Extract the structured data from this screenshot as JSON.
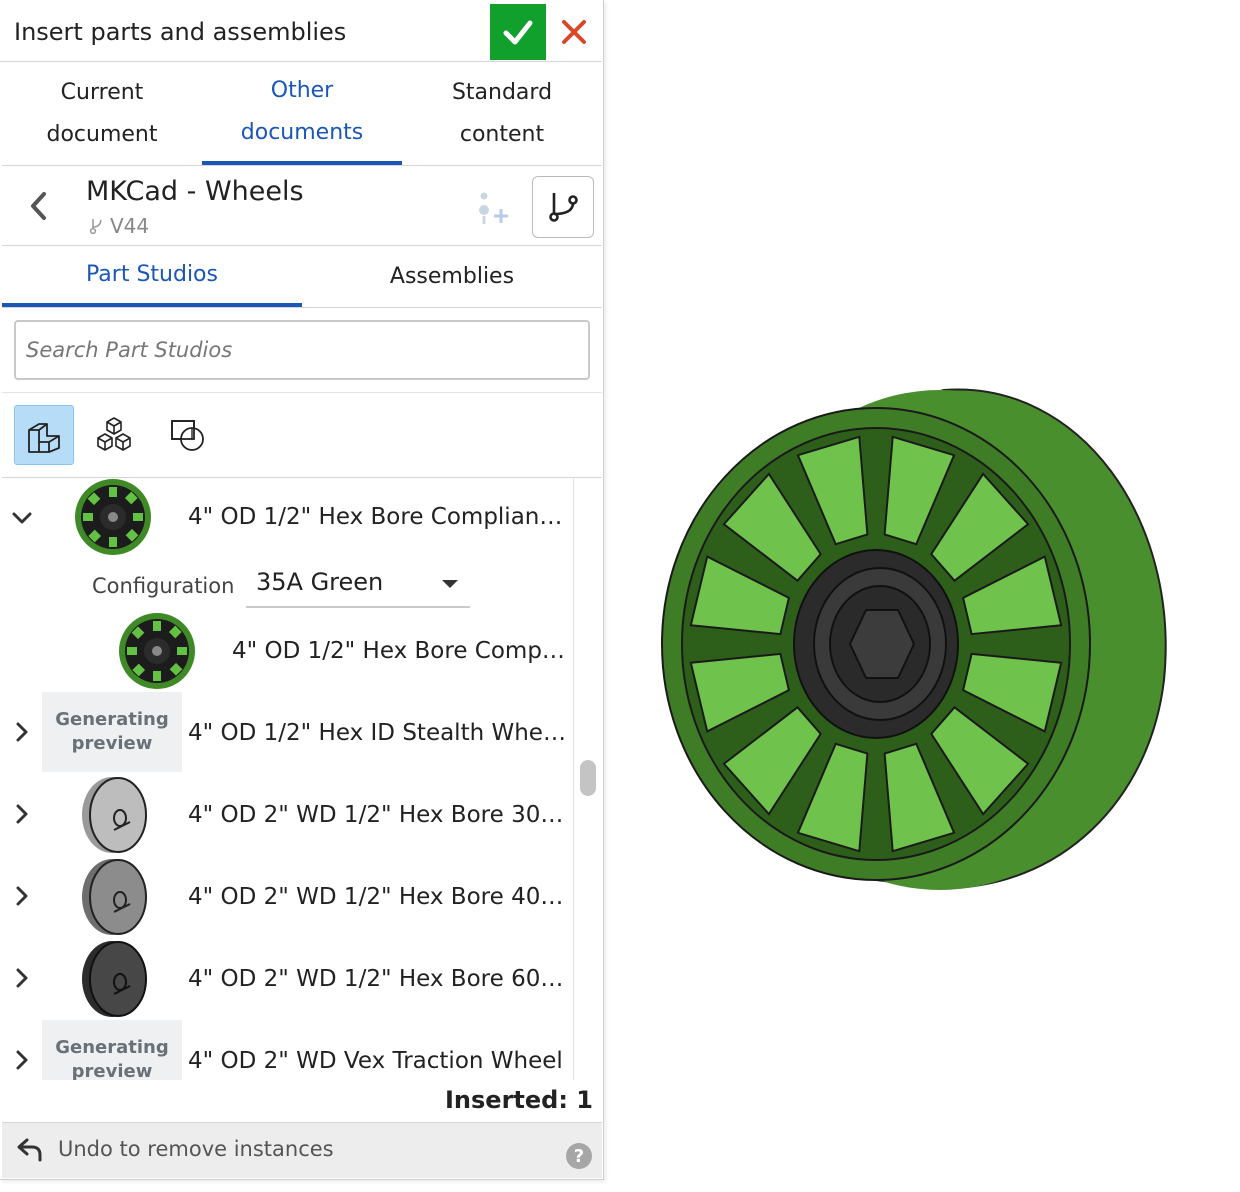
{
  "dialog": {
    "title": "Insert parts and assemblies",
    "accept_icon": "check-icon",
    "cancel_icon": "close-icon"
  },
  "top_tabs": [
    {
      "line1": "Current",
      "line2": "document",
      "active": false
    },
    {
      "line1": "Other",
      "line2": "documents",
      "active": true
    },
    {
      "line1": "Standard",
      "line2": "content",
      "active": false
    }
  ],
  "document": {
    "name": "MKCad - Wheels",
    "version": "V44"
  },
  "sub_tabs": [
    {
      "label": "Part Studios",
      "active": true
    },
    {
      "label": "Assemblies",
      "active": false
    }
  ],
  "search": {
    "placeholder": "Search Part Studios",
    "value": ""
  },
  "filters": [
    {
      "icon": "part-studio-icon",
      "active": true
    },
    {
      "icon": "parts-icon",
      "active": false
    },
    {
      "icon": "sketch-icon",
      "active": false
    }
  ],
  "items": [
    {
      "label": "4\" OD 1/2\" Hex Bore Compliant ...",
      "expanded": true,
      "preview": "green-wheel"
    },
    {
      "label": "4\" OD 1/2\" Hex Bore Compli...",
      "child": true,
      "preview": "green-wheel"
    },
    {
      "label": "4\" OD 1/2\" Hex ID Stealth Whee...",
      "expanded": false,
      "preview": "generating"
    },
    {
      "label": "4\" OD 2\" WD 1/2\" Hex Bore 30A...",
      "expanded": false,
      "preview": "gray-light"
    },
    {
      "label": "4\" OD 2\" WD 1/2\" Hex Bore 40A...",
      "expanded": false,
      "preview": "gray-mid"
    },
    {
      "label": "4\" OD 2\" WD 1/2\" Hex Bore 60A...",
      "expanded": false,
      "preview": "gray-dark"
    },
    {
      "label": "4\" OD 2\" WD Vex Traction Wheel",
      "expanded": false,
      "preview": "generating"
    }
  ],
  "generating_preview": {
    "line1": "Generating",
    "line2": "preview"
  },
  "configuration": {
    "label": "Configuration",
    "value": "35A Green"
  },
  "inserted_text": "Inserted: 1",
  "footer": {
    "undo_label": "Undo to remove instances",
    "help": "?"
  },
  "colors": {
    "accent": "#1a57b8",
    "accept": "#12a02d",
    "cancel": "#d9472b",
    "wheel_green": "#56a838"
  }
}
